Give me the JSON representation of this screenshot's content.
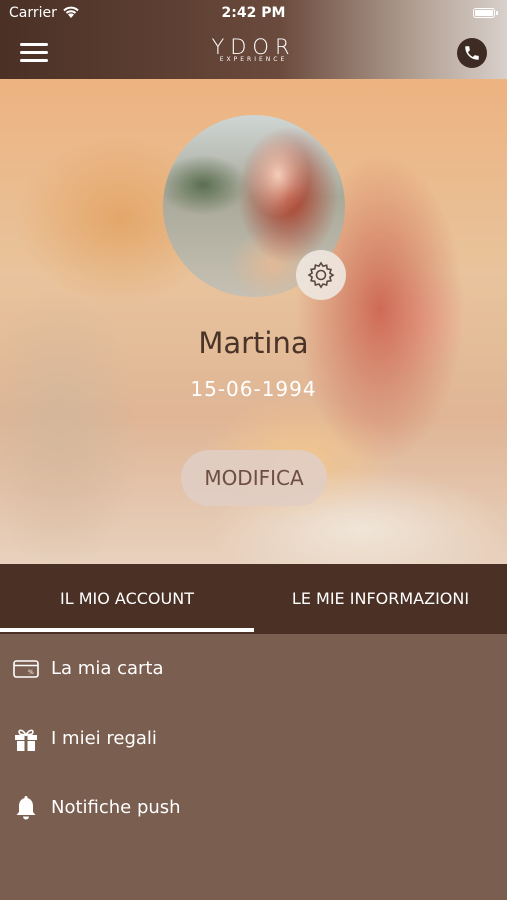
{
  "status_bar": {
    "carrier": "Carrier",
    "time": "2:42 PM"
  },
  "header": {
    "logo": "YDOR",
    "logo_sub": "EXPERIENCE"
  },
  "profile": {
    "name": "Martina",
    "birth_date": "15-06-1994",
    "edit_label": "MODIFICA"
  },
  "tabs": [
    {
      "label": "IL MIO ACCOUNT",
      "active": true
    },
    {
      "label": "LE MIE INFORMAZIONI",
      "active": false
    }
  ],
  "menu": [
    {
      "label": "La mia carta",
      "icon": "card-icon"
    },
    {
      "label": "I miei regali",
      "icon": "gift-icon"
    },
    {
      "label": "Notifiche push",
      "icon": "bell-icon"
    }
  ],
  "colors": {
    "primary": "#4a3025",
    "list_bg": "#7a5e50",
    "button_bg": "#e1cdc3"
  }
}
